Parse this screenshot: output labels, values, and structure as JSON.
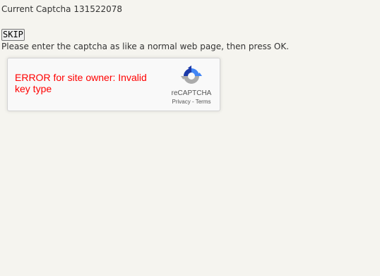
{
  "captcha": {
    "label": "Current Captcha",
    "id": "131522078"
  },
  "skip_button": {
    "label": "SKIP"
  },
  "instructions": "Please enter the captcha as like a normal web page, then press OK.",
  "recaptcha": {
    "error_text": "ERROR for site owner: Invalid key type",
    "brand": "reCAPTCHA",
    "privacy_label": "Privacy",
    "separator": " - ",
    "terms_label": "Terms",
    "colors": {
      "error": "#ff0000",
      "logo_blue": "#1c3aa9",
      "logo_light_blue": "#4285f4",
      "logo_gray": "#ababab"
    },
    "icon": "recaptcha-logo-icon"
  }
}
